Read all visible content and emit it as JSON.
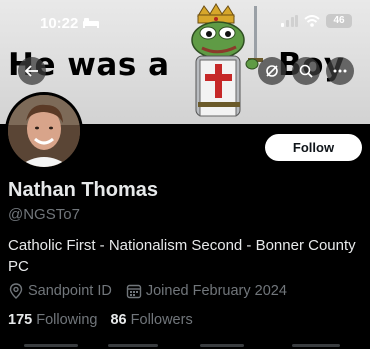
{
  "status_bar": {
    "time": "10:22",
    "battery": "46"
  },
  "banner": {
    "text_left": "He was a",
    "text_right": "Boy"
  },
  "profile": {
    "follow_label": "Follow",
    "name": "Nathan Thomas",
    "handle": "@NGSTo7",
    "bio": "Catholic First - Nationalism Second - Bonner County PC",
    "location": "Sandpoint ID",
    "joined": "Joined February 2024",
    "following_count": "175",
    "following_label": "Following",
    "followers_count": "86",
    "followers_label": "Followers"
  },
  "colors": {
    "background": "#000000",
    "muted": "#71767b",
    "text": "#e7e9ea",
    "follow_bg": "#ffffff"
  },
  "icons": [
    "back-arrow-icon",
    "grok-icon",
    "search-icon",
    "more-icon",
    "location-icon",
    "calendar-icon",
    "wifi-icon",
    "signal-icon",
    "bed-icon"
  ]
}
